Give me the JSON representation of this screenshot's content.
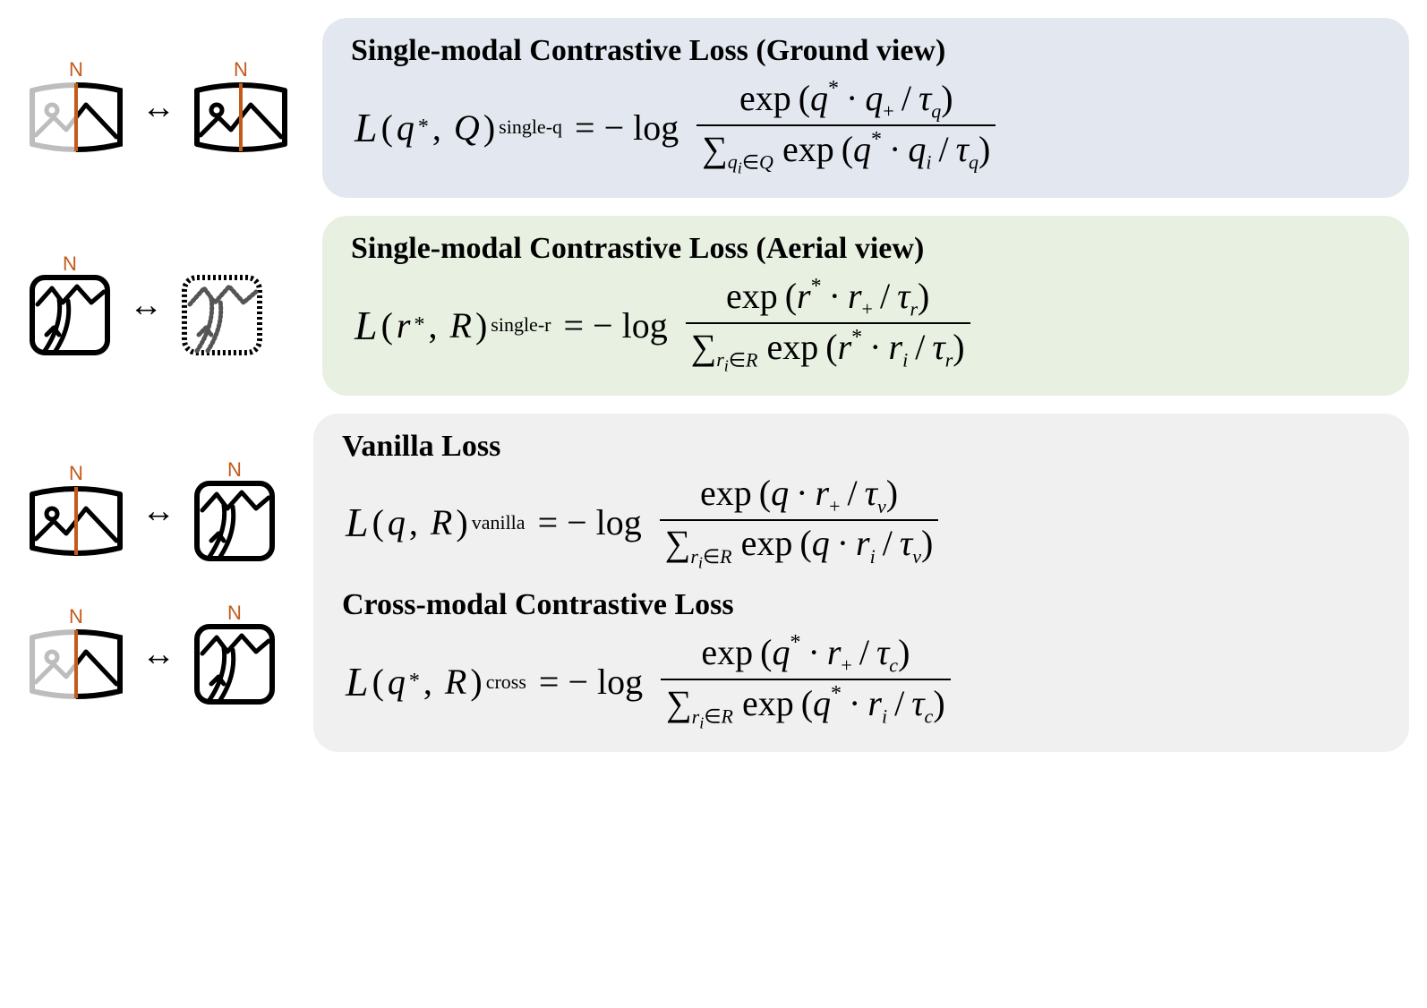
{
  "labels": {
    "north": "N"
  },
  "arrow": "↔",
  "sections": {
    "ground": {
      "title": "Single-modal Contrastive Loss (Ground view)",
      "lhs_sub": "single-q",
      "arg1": "q*",
      "arg2": "Q",
      "num": "exp ( q* · q₊ / τ_q )",
      "den": "∑_{q_i ∈ Q} exp ( q* · q_i / τ_q )"
    },
    "aerial": {
      "title": "Single-modal Contrastive Loss (Aerial view)",
      "lhs_sub": "single-r",
      "arg1": "r*",
      "arg2": "R",
      "num": "exp ( r* · r₊ / τ_r )",
      "den": "∑_{r_i ∈ R} exp ( r* · r_i / τ_r )"
    },
    "vanilla": {
      "title": "Vanilla Loss",
      "lhs_sub": "vanilla",
      "arg1": "q",
      "arg2": "R",
      "num": "exp ( q · r₊ / τ_v )",
      "den": "∑_{r_i ∈ R} exp ( q · r_i / τ_v )"
    },
    "cross": {
      "title": "Cross-modal Contrastive Loss",
      "lhs_sub": "cross",
      "arg1": "q*",
      "arg2": "R",
      "num": "exp ( q* · r₊ / τ_c )",
      "den": "∑_{r_i ∈ R} exp ( q* · r_i / τ_c )"
    }
  }
}
